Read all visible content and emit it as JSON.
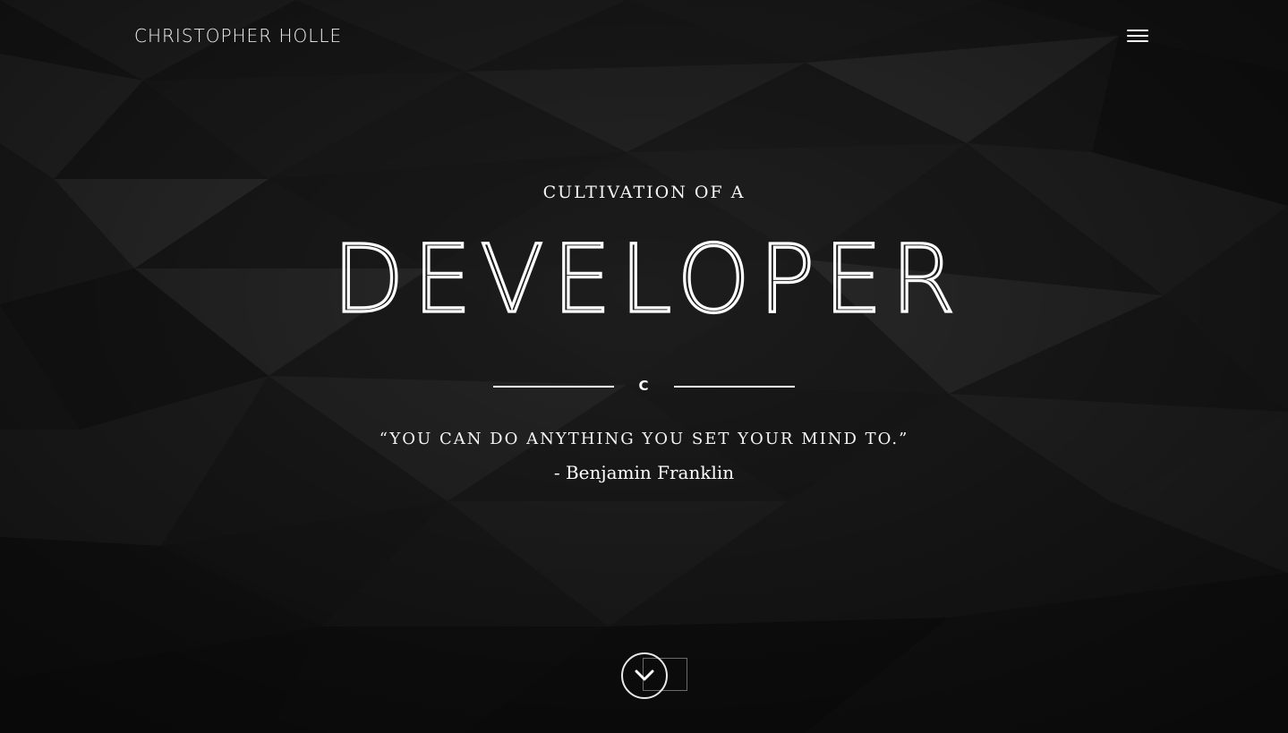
{
  "header": {
    "brand": "CHRISTOPHER HOLLE",
    "menu_icon": "hamburger-menu-icon"
  },
  "hero": {
    "kicker": "CULTIVATION OF A",
    "headline": "DEVELOPER",
    "divider_glyph": "C",
    "quote": "“YOU CAN DO ANYTHING YOU SET YOUR MIND TO.”",
    "author": "- Benjamin Franklin"
  },
  "scroll": {
    "icon": "chevron-down-icon"
  },
  "colors": {
    "background": "#1b1b1b",
    "text": "#ffffff"
  }
}
